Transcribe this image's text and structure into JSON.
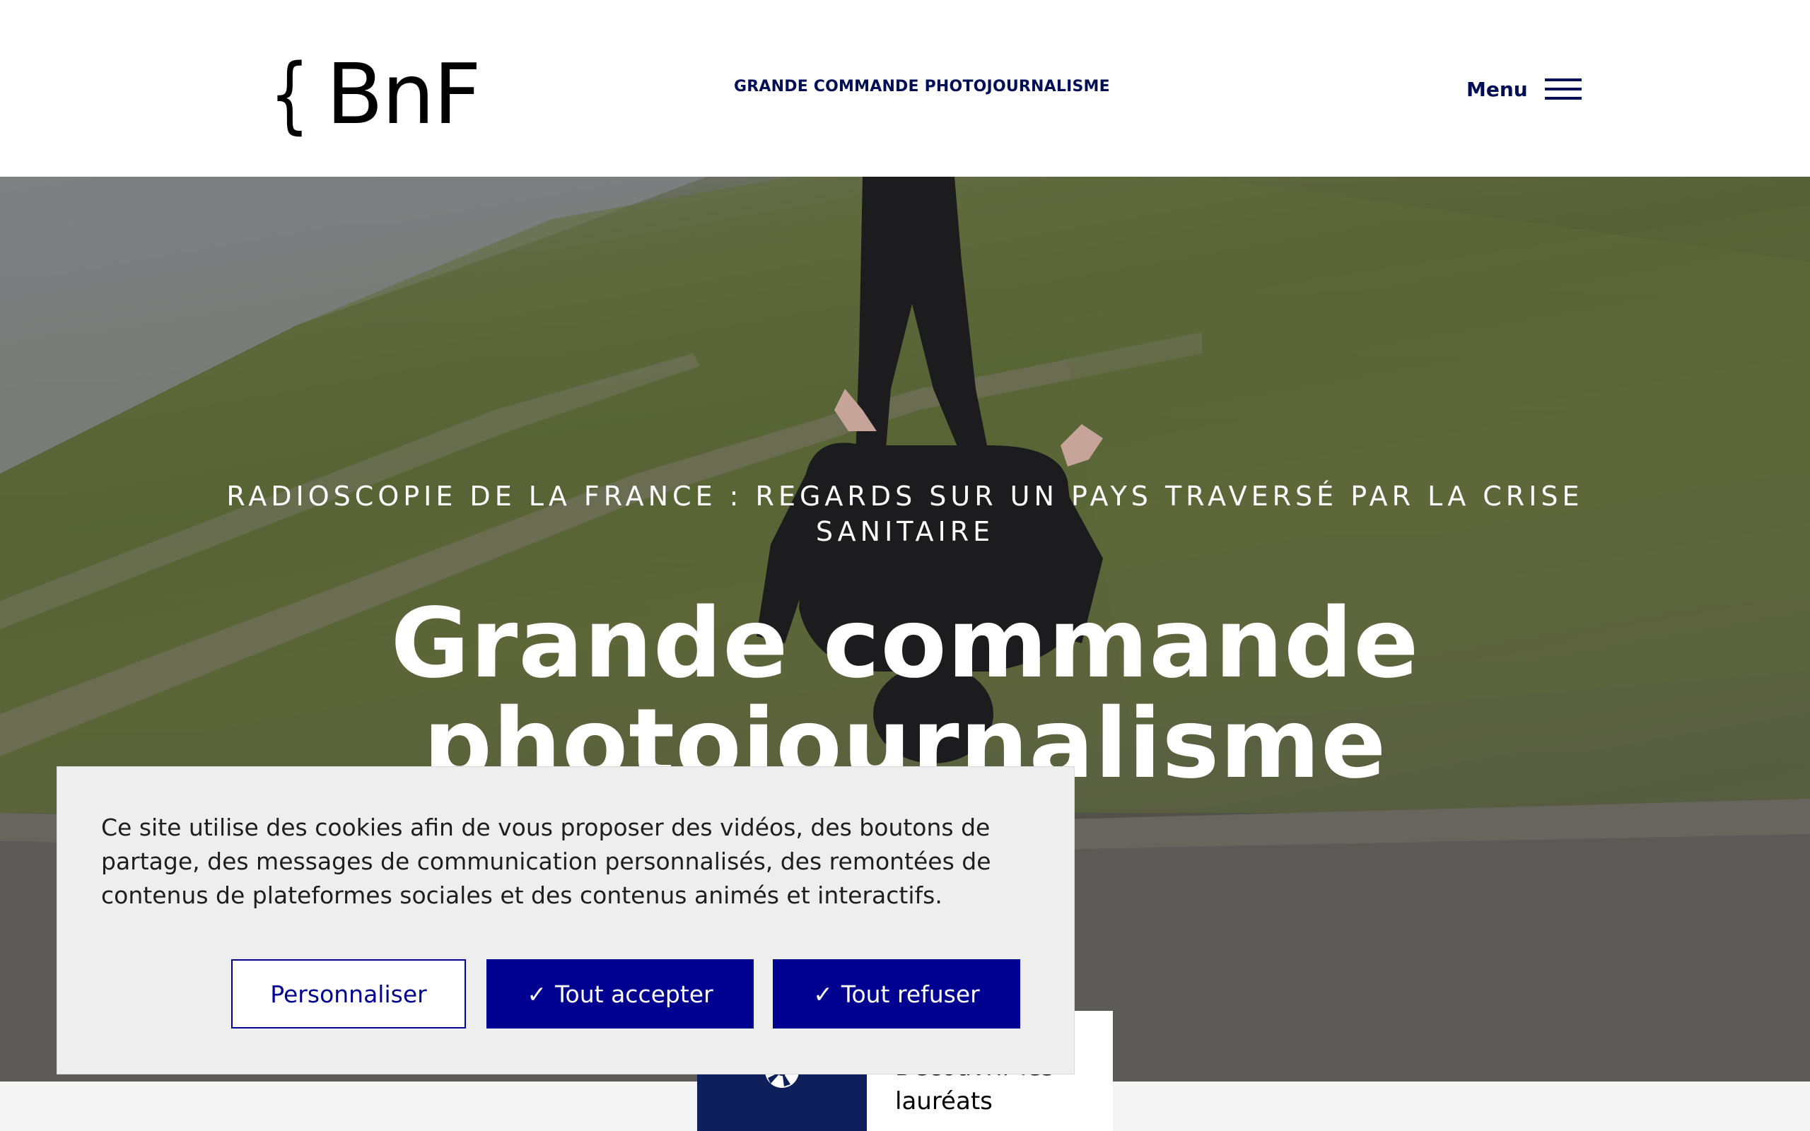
{
  "header": {
    "logo_brace": "{",
    "logo_text": "BnF",
    "site_title": "GRANDE COMMANDE PHOTOJOURNALISME",
    "menu_label": "Menu",
    "menu_icon": "hamburger-icon"
  },
  "hero": {
    "kicker": "RADIOSCOPIE DE LA FRANCE : REGARDS SUR UN PAYS TRAVERSÉ PAR LA CRISE SANITAIRE",
    "title": "Grande commande photojournalisme"
  },
  "laureates": {
    "icon": "camera-aperture-icon",
    "label": "Découvrir les lauréats"
  },
  "cookie": {
    "message": "Ce site utilise des cookies afin de vous proposer des vidéos, des boutons de partage, des messages de communication personnalisés, des remontées de contenus de plateformes sociales et des contenus animés et interactifs.",
    "personalize_label": "Personnaliser",
    "accept_label": "Tout accepter",
    "refuse_label": "Tout refuser",
    "check_glyph": "✓"
  },
  "colors": {
    "navy": "#000f55",
    "button_blue": "#000091",
    "icon_box": "#0f1f5c"
  }
}
